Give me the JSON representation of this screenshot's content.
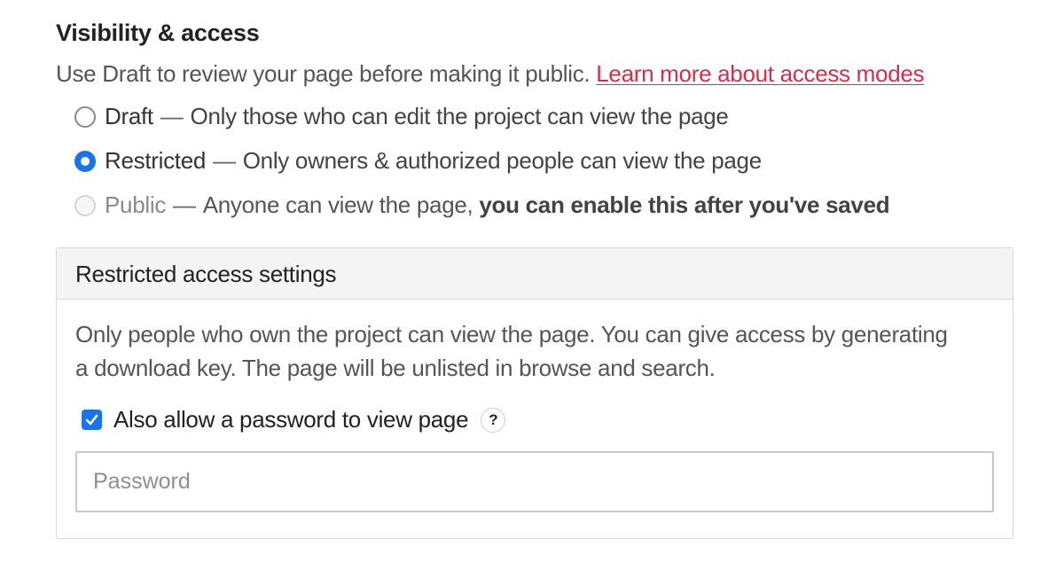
{
  "section": {
    "title": "Visibility & access",
    "intro_text": "Use Draft to review your page before making it public.",
    "intro_link": "Learn more about access modes"
  },
  "options": [
    {
      "name": "Draft",
      "separator": "—",
      "description": "Only those who can edit the project can view the page",
      "selected": false,
      "disabled": false
    },
    {
      "name": "Restricted",
      "separator": "—",
      "description": "Only owners & authorized people can view the page",
      "selected": true,
      "disabled": false
    },
    {
      "name": "Public",
      "separator": "—",
      "description": "Anyone can view the page,",
      "description_bold": "you can enable this after you've saved",
      "selected": false,
      "disabled": true
    }
  ],
  "restricted_panel": {
    "title": "Restricted access settings",
    "description": "Only people who own the project can view the page. You can give access by generating a download key. The page will be unlisted in browse and search.",
    "password_checkbox_label": "Also allow a password to view page",
    "password_checkbox_checked": true,
    "help_label": "?",
    "password_placeholder": "Password",
    "password_value": ""
  },
  "colors": {
    "accent": "#1a73e8",
    "link": "#da2c49"
  }
}
